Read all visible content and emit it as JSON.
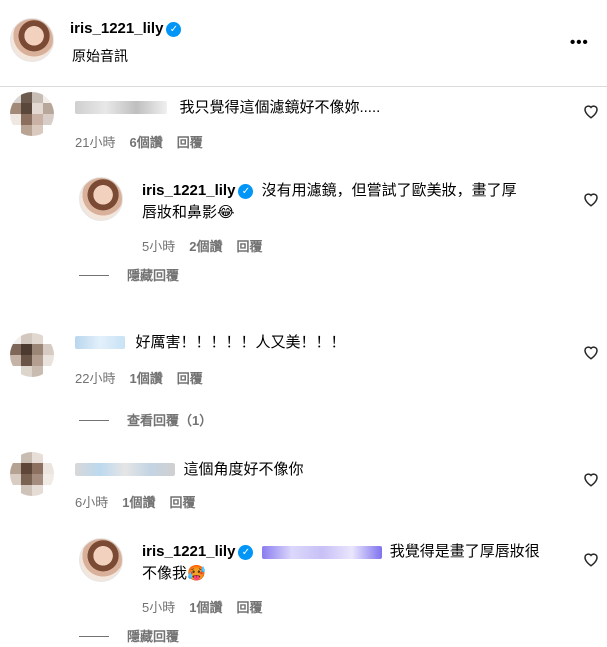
{
  "header": {
    "username": "iris_1221_lily",
    "subtitle": "原始音訊",
    "more": "•••"
  },
  "comments": [
    {
      "text": "我只覺得這個濾鏡好不像妳.....",
      "time": "21小時",
      "likes": "6個讚",
      "reply": "回覆"
    },
    {
      "username": "iris_1221_lily",
      "text1": "沒有用濾鏡，但嘗試了歐美妝，畫了厚",
      "text2": "唇妝和鼻影",
      "emoji": "😂",
      "time": "5小時",
      "likes": "2個讚",
      "reply": "回覆",
      "hide": "隱藏回覆"
    },
    {
      "text": "好厲害！！！！！人又美！！！",
      "time": "22小時",
      "likes": "1個讚",
      "reply": "回覆",
      "view": "查看回覆（1）"
    },
    {
      "text": "這個角度好不像你",
      "time": "6小時",
      "likes": "1個讚",
      "reply": "回覆"
    },
    {
      "username": "iris_1221_lily",
      "text1": "我覺得是畫了厚唇妝很",
      "text2": "不像我",
      "emoji": "🥵",
      "time": "5小時",
      "likes": "1個讚",
      "reply": "回覆",
      "hide": "隱藏回覆"
    }
  ]
}
